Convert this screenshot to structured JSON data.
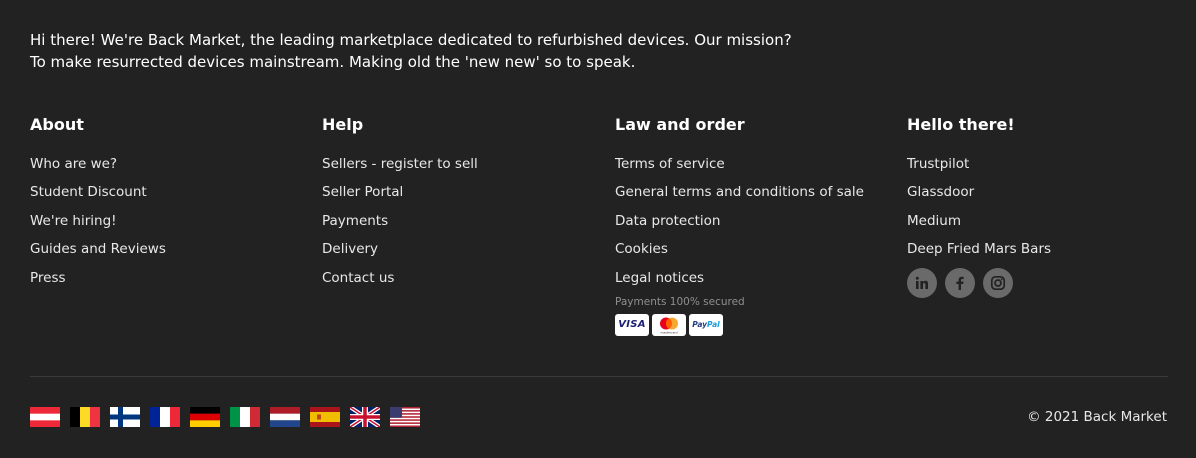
{
  "intro": {
    "line1": "Hi there! We're Back Market, the leading marketplace dedicated to refurbished devices. Our mission?",
    "line2": "To make resurrected devices mainstream. Making old the 'new new' so to speak."
  },
  "columns": [
    {
      "title": "About",
      "links": [
        "Who are we?",
        "Student Discount",
        "We're hiring!",
        "Guides and Reviews",
        "Press"
      ]
    },
    {
      "title": "Help",
      "links": [
        "Sellers - register to sell",
        "Seller Portal",
        "Payments",
        "Delivery",
        "Contact us"
      ]
    },
    {
      "title": "Law and order",
      "links": [
        "Terms of service",
        "General terms and conditions of sale",
        "Data protection",
        "Cookies",
        "Legal notices"
      ]
    },
    {
      "title": "Hello there!",
      "links": [
        "Trustpilot",
        "Glassdoor",
        "Medium",
        "Deep Fried Mars Bars"
      ]
    }
  ],
  "payments": {
    "label": "Payments 100% secured",
    "methods": [
      {
        "name": "visa-card-icon",
        "text": "VISA"
      },
      {
        "name": "mastercard-card-icon",
        "text": "mastercard"
      },
      {
        "name": "paypal-card-icon",
        "text_a": "Pay",
        "text_b": "Pal"
      }
    ]
  },
  "social": [
    "linkedin-icon",
    "facebook-icon",
    "instagram-icon"
  ],
  "flags": [
    "austria-flag-icon",
    "belgium-flag-icon",
    "finland-flag-icon",
    "france-flag-icon",
    "germany-flag-icon",
    "italy-flag-icon",
    "netherlands-flag-icon",
    "spain-flag-icon",
    "uk-flag-icon",
    "usa-flag-icon"
  ],
  "copyright": "© 2021 Back Market",
  "colors": {
    "background": "#222222",
    "text": "#ffffff",
    "muted": "#8f8f8f",
    "divider": "#3a3a3a",
    "social_bg": "#6a6a6a"
  }
}
